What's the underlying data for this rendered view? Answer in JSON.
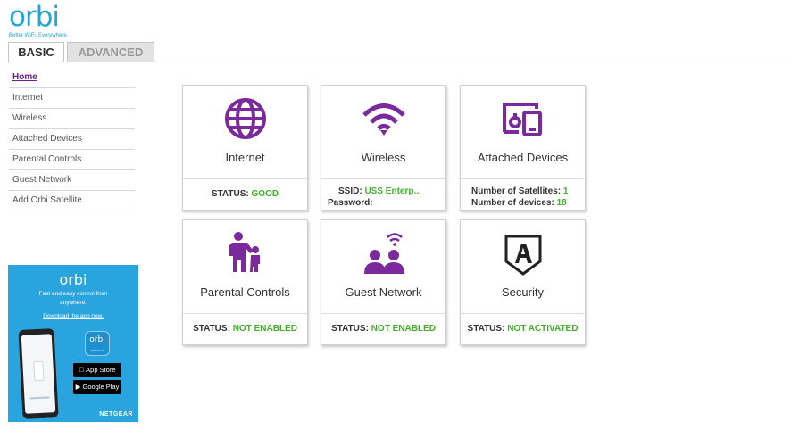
{
  "header": {
    "logo_text": "orbi",
    "logo_tm": "TM",
    "tagline": "Better WiFi. Everywhere."
  },
  "tabs": [
    {
      "label": "BASIC",
      "active": true
    },
    {
      "label": "ADVANCED",
      "active": false
    }
  ],
  "sidebar": {
    "items": [
      {
        "label": "Home",
        "active": true
      },
      {
        "label": "Internet"
      },
      {
        "label": "Wireless"
      },
      {
        "label": "Attached Devices"
      },
      {
        "label": "Parental Controls"
      },
      {
        "label": "Guest Network"
      },
      {
        "label": "Add Orbi Satellite"
      }
    ]
  },
  "ad": {
    "logo": "orbi",
    "text_line1": "Fast and easy control from",
    "text_line2": "anywhere.",
    "link": "Download the app now.",
    "app_icon_label": "orbi",
    "app_icon_sub": "NETGEAR",
    "app_store_small": "Download on the",
    "app_store": "App Store",
    "google_play_small": "GET IT ON",
    "google_play": "Google Play",
    "brand": "NETGEAR"
  },
  "cards": {
    "internet": {
      "title": "Internet",
      "status_label": "STATUS:",
      "status_value": "GOOD",
      "icon": "globe-icon"
    },
    "wireless": {
      "title": "Wireless",
      "ssid_label": "SSID:",
      "ssid_value": "USS Enterp...",
      "password_label": "Password:",
      "icon": "wifi-icon"
    },
    "attached_devices": {
      "title": "Attached Devices",
      "satellites_label": "Number of Satellites:",
      "satellites_value": "1",
      "devices_label": "Number of devices:",
      "devices_value": "18",
      "icon": "devices-icon"
    },
    "parental_controls": {
      "title": "Parental Controls",
      "status_label": "STATUS:",
      "status_value": "NOT ENABLED",
      "icon": "parent-child-icon"
    },
    "guest_network": {
      "title": "Guest Network",
      "status_label": "STATUS:",
      "status_value": "NOT ENABLED",
      "icon": "guests-wifi-icon"
    },
    "security": {
      "title": "Security",
      "status_label": "STATUS:",
      "status_value": "NOT ACTIVATED",
      "icon": "armor-shield-icon"
    }
  },
  "colors": {
    "brand_blue": "#23a3dc",
    "icon_purple": "#7b2a9e",
    "status_green": "#42b02a",
    "active_nav": "#6b1f8a"
  }
}
